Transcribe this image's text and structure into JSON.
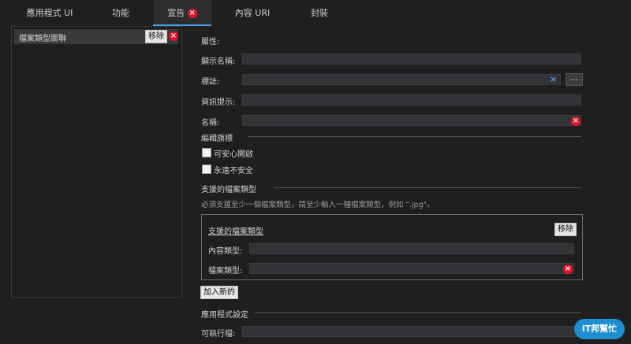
{
  "tabs": [
    {
      "label": "應用程式 UI"
    },
    {
      "label": "功能"
    },
    {
      "label": "宣告"
    },
    {
      "label": "內容 URI"
    },
    {
      "label": "封裝"
    }
  ],
  "left_panel": {
    "item_label": "檔案類型關聯",
    "remove_label": "移除"
  },
  "properties": {
    "heading": "屬性:",
    "display_name": {
      "label": "顯示名稱:",
      "value": ""
    },
    "logo": {
      "label": "標誌:",
      "value": "",
      "browse_label": "..."
    },
    "info_tip": {
      "label": "資訊提示:",
      "value": ""
    },
    "name": {
      "label": "名稱:",
      "value": ""
    }
  },
  "edit_flags": {
    "heading": "編輯旗標",
    "open_safe": {
      "label": "可安心開啟",
      "checked": false
    },
    "always_unsafe": {
      "label": "永遠不安全",
      "checked": false
    }
  },
  "supported_types": {
    "heading": "支援的檔案類型",
    "hint": "必須支援至少一個檔案類型，請至少輸入一種檔案類型，例如 \".jpg\"。",
    "group_title": "支援的檔案類型",
    "remove_label": "移除",
    "content_type": {
      "label": "內容類型:",
      "value": ""
    },
    "file_type": {
      "label": "檔案類型:",
      "value": ""
    },
    "add_new_label": "加入新的"
  },
  "app_settings": {
    "heading": "應用程式設定",
    "executable": {
      "label": "可執行檔:",
      "value": ""
    }
  },
  "watermark": {
    "text": "iT邦幫忙"
  },
  "colors": {
    "accent": "#3f9ee8",
    "error": "#e81123"
  }
}
